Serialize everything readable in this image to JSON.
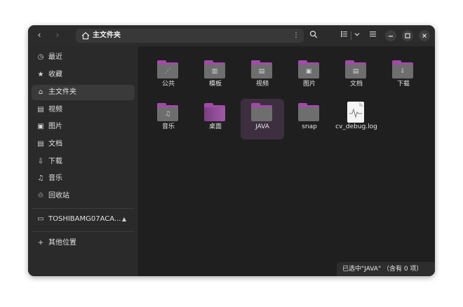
{
  "window": {
    "path": "主文件夹",
    "nav": {
      "back": "‹",
      "forward": "›"
    },
    "path_menu_icon": "⋮"
  },
  "sidebar": {
    "items": [
      {
        "label": "最近",
        "icon": "clock-icon",
        "glyph": "◷"
      },
      {
        "label": "收藏",
        "icon": "star-icon",
        "glyph": "★"
      },
      {
        "label": "主文件夹",
        "icon": "home-icon",
        "glyph": "⌂",
        "selected": true
      },
      {
        "label": "视频",
        "icon": "video-icon",
        "glyph": "▤"
      },
      {
        "label": "图片",
        "icon": "image-icon",
        "glyph": "▣"
      },
      {
        "label": "文档",
        "icon": "document-icon",
        "glyph": "▤"
      },
      {
        "label": "下载",
        "icon": "download-icon",
        "glyph": "⇩"
      },
      {
        "label": "音乐",
        "icon": "music-icon",
        "glyph": "♫"
      },
      {
        "label": "回收站",
        "icon": "trash-icon",
        "glyph": "♲"
      }
    ],
    "drive": {
      "label": "TOSHIBAMG07ACA...",
      "icon": "drive-icon",
      "glyph": "▭",
      "eject": "▲"
    },
    "other": {
      "label": "其他位置",
      "icon": "plus-icon",
      "glyph": "+"
    }
  },
  "files": [
    {
      "label": "公共",
      "kind": "folder",
      "glyph": "⋰"
    },
    {
      "label": "模板",
      "kind": "folder",
      "glyph": "▥"
    },
    {
      "label": "视频",
      "kind": "folder",
      "glyph": "▤"
    },
    {
      "label": "图片",
      "kind": "folder",
      "glyph": "▣"
    },
    {
      "label": "文档",
      "kind": "folder",
      "glyph": "▤"
    },
    {
      "label": "下载",
      "kind": "folder",
      "glyph": "⇩"
    },
    {
      "label": "音乐",
      "kind": "folder",
      "glyph": "♫"
    },
    {
      "label": "桌面",
      "kind": "desktop",
      "glyph": ""
    },
    {
      "label": "JAVA",
      "kind": "folder",
      "glyph": "",
      "selected": true
    },
    {
      "label": "snap",
      "kind": "folder",
      "glyph": ""
    },
    {
      "label": "cv_debug.log",
      "kind": "document",
      "glyph": "∿"
    }
  ],
  "status": "已选中\"JAVA\" （含有 0 项）",
  "colors": {
    "accent": "#a14aa8",
    "window_bg": "#1f1f1f",
    "sidebar_bg": "#2a2a2a"
  }
}
